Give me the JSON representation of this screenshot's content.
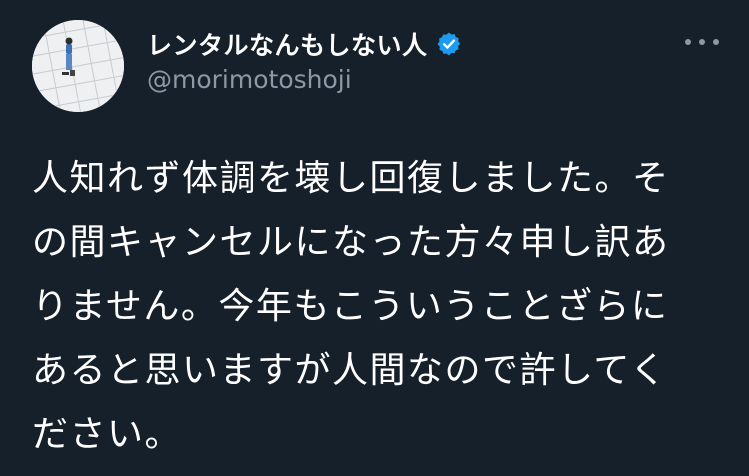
{
  "author": {
    "display_name": "レンタルなんもしない人",
    "handle": "@morimotoshoji",
    "verified_icon": "verified-badge-icon",
    "avatar_icon": "profile-photo"
  },
  "more_icon": "more-horizontal-icon",
  "tweet": {
    "lines": [
      "人知れず体調を壊し回復しました。そ",
      "の間キャンセルになった方々申し訳あ",
      "りません。今年もこういうことざらに",
      "あると思いますが人間なので許してく",
      "ださい。"
    ]
  },
  "colors": {
    "background": "#15202b",
    "text": "#ffffff",
    "secondary_text": "#8b98a5",
    "verified": "#1d9bf0"
  }
}
